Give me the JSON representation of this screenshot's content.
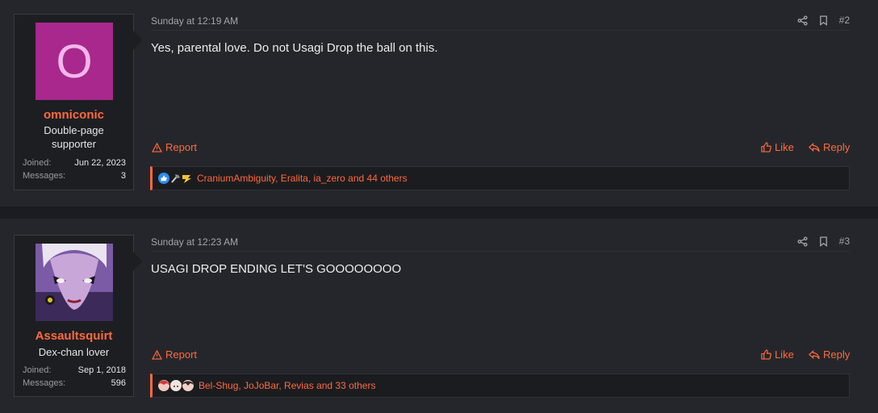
{
  "posts": [
    {
      "avatar_letter": "O",
      "username": "omniconic",
      "user_title": "Double-page supporter",
      "joined_label": "Joined:",
      "joined": "Jun 22, 2023",
      "messages_label": "Messages:",
      "messages": "3",
      "date": "Sunday at 12:19 AM",
      "number": "#2",
      "body": "Yes, parental love. Do not Usagi Drop the ball on this.",
      "report_label": "Report",
      "like_label": "Like",
      "reply_label": "Reply",
      "reactions_text": "CraniumAmbiguity, Eralita, ia_zero and 44 others"
    },
    {
      "username": "Assaultsquirt",
      "user_title": "Dex-chan lover",
      "joined_label": "Joined:",
      "joined": "Sep 1, 2018",
      "messages_label": "Messages:",
      "messages": "596",
      "date": "Sunday at 12:23 AM",
      "number": "#3",
      "body": "USAGI DROP ENDING LET'S GOOOOOOOO",
      "report_label": "Report",
      "like_label": "Like",
      "reply_label": "Reply",
      "reactions_text": "Bel-Shug, JoJoBar, Revias and 33 others"
    }
  ],
  "colors": {
    "accent": "#ff6a3d",
    "avatar_bg": "#a8288d",
    "post_bg": "#25262b",
    "page_bg": "#1b1c21"
  }
}
